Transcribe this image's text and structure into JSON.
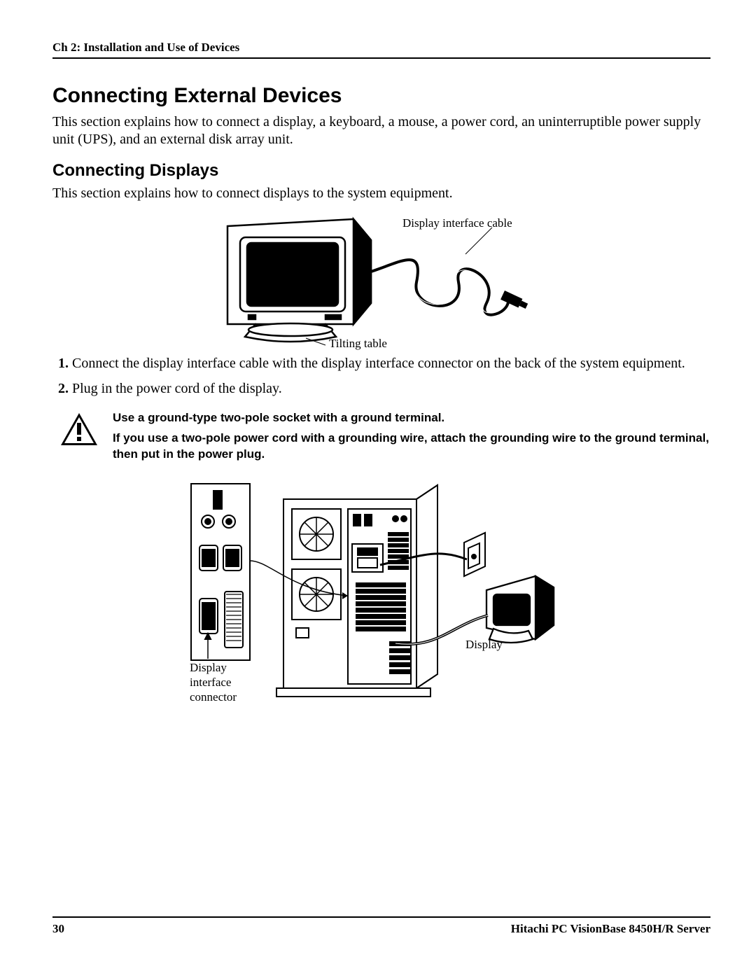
{
  "header": {
    "chapter_label": "Ch 2: Installation and Use of Devices"
  },
  "headings": {
    "h1": "Connecting External Devices",
    "h2": "Connecting Displays"
  },
  "paragraphs": {
    "intro1": "This section explains how to connect a display, a keyboard, a mouse, a power cord, an uninterruptible power supply unit (UPS), and an external disk array unit.",
    "intro2": "This section explains how to connect displays to the system equipment."
  },
  "figure1_labels": {
    "cable": "Display interface cable",
    "tilting_table": "Tilting table"
  },
  "steps": [
    "Connect the display interface cable with the display interface connector on the back of the system equipment.",
    "Plug in the power cord of the display."
  ],
  "warning": {
    "line1": "Use a ground-type two-pole socket with a ground terminal.",
    "line2": "If you use a two-pole power cord with a grounding wire, attach the grounding wire to the ground terminal, then put in the power plug."
  },
  "figure2_labels": {
    "display": "Display",
    "connector1": "Display",
    "connector2": "interface",
    "connector3": "connector"
  },
  "footer": {
    "page_number": "30",
    "product": "Hitachi PC VisionBase 8450H/R Server"
  }
}
